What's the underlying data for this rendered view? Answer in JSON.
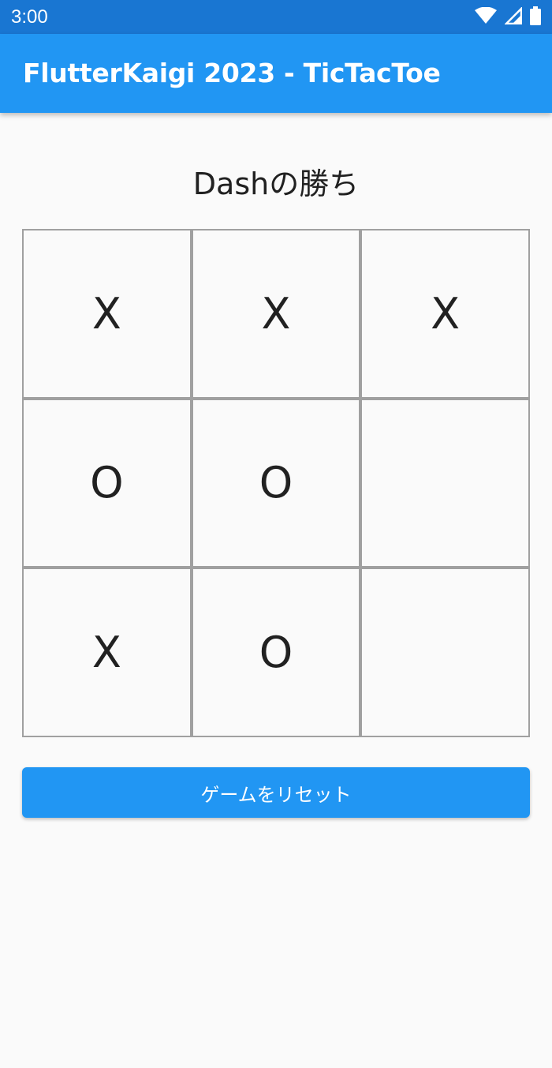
{
  "status_bar": {
    "time": "3:00",
    "icons": [
      "wifi-icon",
      "cell-signal-icon",
      "battery-icon"
    ],
    "color": "#1976d2"
  },
  "app_bar": {
    "title": "FlutterKaigi 2023 - TicTacToe",
    "color": "#2196f3"
  },
  "game": {
    "status": "Dashの勝ち",
    "board": [
      [
        "X",
        "X",
        "X"
      ],
      [
        "O",
        "O",
        ""
      ],
      [
        "X",
        "O",
        ""
      ]
    ]
  },
  "reset_button": {
    "label": "ゲームをリセット",
    "color": "#2196f3"
  }
}
